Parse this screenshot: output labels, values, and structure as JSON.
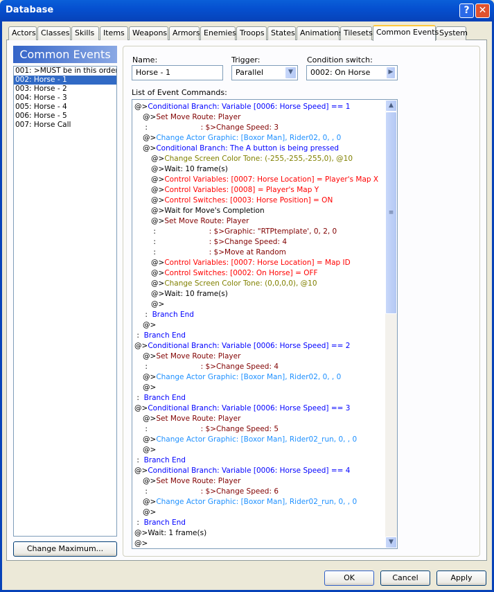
{
  "window": {
    "title": "Database",
    "help_label": "?",
    "close_label": "✕"
  },
  "tabs": [
    "Actors",
    "Classes",
    "Skills",
    "Items",
    "Weapons",
    "Armors",
    "Enemies",
    "Troops",
    "States",
    "Animations",
    "Tilesets",
    "Common Events",
    "System"
  ],
  "active_tab": "Common Events",
  "sidebar": {
    "header": "Common Events",
    "items": [
      "001: >MUST be in this order<",
      "002: Horse - 1",
      "003: Horse - 2",
      "004: Horse - 3",
      "005: Horse - 4",
      "006: Horse - 5",
      "007: Horse Call"
    ],
    "selected_index": 1,
    "change_max_label": "Change Maximum..."
  },
  "form": {
    "name_label": "Name:",
    "name_value": "Horse - 1",
    "trigger_label": "Trigger:",
    "trigger_value": "Parallel",
    "condition_label": "Condition switch:",
    "condition_value": "0002: On Horse",
    "list_label": "List of Event Commands:"
  },
  "colors": {
    "branch": "#0000ff",
    "route": "#800000",
    "graphic": "#1e90ff",
    "tone": "#808000",
    "control": "#ff0000",
    "plain": "#000000",
    "selected": "#316ac5"
  },
  "commands": [
    {
      "i": 0,
      "p": "@>",
      "t": "Conditional Branch: Variable [0006: Horse Speed] == 1",
      "c": "branch"
    },
    {
      "i": 1,
      "p": "@>",
      "t": "Set Move Route: Player",
      "c": "route"
    },
    {
      "i": 1,
      "p": " :",
      "t": "                       : $>Change Speed: 3",
      "c": "route"
    },
    {
      "i": 1,
      "p": "@>",
      "t": "Change Actor Graphic: [Boxor Man], Rider02, 0, , 0",
      "c": "graphic"
    },
    {
      "i": 1,
      "p": "@>",
      "t": "Conditional Branch: The A button is being pressed",
      "c": "branch"
    },
    {
      "i": 2,
      "p": "@>",
      "t": "Change Screen Color Tone: (-255,-255,-255,0), @10",
      "c": "tone"
    },
    {
      "i": 2,
      "p": "@>",
      "t": "Wait: 10 frame(s)",
      "c": "plain"
    },
    {
      "i": 2,
      "p": "@>",
      "t": "Control Variables: [0007: Horse Location] = Player's Map X",
      "c": "control"
    },
    {
      "i": 2,
      "p": "@>",
      "t": "Control Variables: [0008] = Player's Map Y",
      "c": "control"
    },
    {
      "i": 2,
      "p": "@>",
      "t": "Control Switches: [0003: Horse Position] = ON",
      "c": "control"
    },
    {
      "i": 2,
      "p": "@>",
      "t": "Wait for Move's Completion",
      "c": "plain"
    },
    {
      "i": 2,
      "p": "@>",
      "t": "Set Move Route: Player",
      "c": "route"
    },
    {
      "i": 2,
      "p": " :",
      "t": "                       : $>Graphic: \"RTPtemplate', 0, 2, 0",
      "c": "route"
    },
    {
      "i": 2,
      "p": " :",
      "t": "                       : $>Change Speed: 4",
      "c": "route"
    },
    {
      "i": 2,
      "p": " :",
      "t": "                       : $>Move at Random",
      "c": "route"
    },
    {
      "i": 2,
      "p": "@>",
      "t": "Control Variables: [0007: Horse Location] = Map ID",
      "c": "control"
    },
    {
      "i": 2,
      "p": "@>",
      "t": "Control Switches: [0002: On Horse] = OFF",
      "c": "control"
    },
    {
      "i": 2,
      "p": "@>",
      "t": "Change Screen Color Tone: (0,0,0,0), @10",
      "c": "tone"
    },
    {
      "i": 2,
      "p": "@>",
      "t": "Wait: 10 frame(s)",
      "c": "plain"
    },
    {
      "i": 2,
      "p": "@>",
      "t": "",
      "c": "plain"
    },
    {
      "i": 1,
      "p": " :",
      "t": "  Branch End",
      "c": "branch"
    },
    {
      "i": 1,
      "p": "@>",
      "t": "",
      "c": "plain"
    },
    {
      "i": 0,
      "p": " :",
      "t": "  Branch End",
      "c": "branch"
    },
    {
      "i": 0,
      "p": "@>",
      "t": "Conditional Branch: Variable [0006: Horse Speed] == 2",
      "c": "branch"
    },
    {
      "i": 1,
      "p": "@>",
      "t": "Set Move Route: Player",
      "c": "route"
    },
    {
      "i": 1,
      "p": " :",
      "t": "                       : $>Change Speed: 4",
      "c": "route"
    },
    {
      "i": 1,
      "p": "@>",
      "t": "Change Actor Graphic: [Boxor Man], Rider02, 0, , 0",
      "c": "graphic"
    },
    {
      "i": 1,
      "p": "@>",
      "t": "",
      "c": "plain"
    },
    {
      "i": 0,
      "p": " :",
      "t": "  Branch End",
      "c": "branch"
    },
    {
      "i": 0,
      "p": "@>",
      "t": "Conditional Branch: Variable [0006: Horse Speed] == 3",
      "c": "branch"
    },
    {
      "i": 1,
      "p": "@>",
      "t": "Set Move Route: Player",
      "c": "route"
    },
    {
      "i": 1,
      "p": " :",
      "t": "                       : $>Change Speed: 5",
      "c": "route"
    },
    {
      "i": 1,
      "p": "@>",
      "t": "Change Actor Graphic: [Boxor Man], Rider02_run, 0, , 0",
      "c": "graphic"
    },
    {
      "i": 1,
      "p": "@>",
      "t": "",
      "c": "plain"
    },
    {
      "i": 0,
      "p": " :",
      "t": "  Branch End",
      "c": "branch"
    },
    {
      "i": 0,
      "p": "@>",
      "t": "Conditional Branch: Variable [0006: Horse Speed] == 4",
      "c": "branch"
    },
    {
      "i": 1,
      "p": "@>",
      "t": "Set Move Route: Player",
      "c": "route"
    },
    {
      "i": 1,
      "p": " :",
      "t": "                       : $>Change Speed: 6",
      "c": "route"
    },
    {
      "i": 1,
      "p": "@>",
      "t": "Change Actor Graphic: [Boxor Man], Rider02_run, 0, , 0",
      "c": "graphic"
    },
    {
      "i": 1,
      "p": "@>",
      "t": "",
      "c": "plain"
    },
    {
      "i": 0,
      "p": " :",
      "t": "  Branch End",
      "c": "branch"
    },
    {
      "i": 0,
      "p": "@>",
      "t": "Wait: 1 frame(s)",
      "c": "plain"
    },
    {
      "i": 0,
      "p": "@>",
      "t": "",
      "c": "plain"
    }
  ],
  "footer": {
    "ok": "OK",
    "cancel": "Cancel",
    "apply": "Apply"
  }
}
